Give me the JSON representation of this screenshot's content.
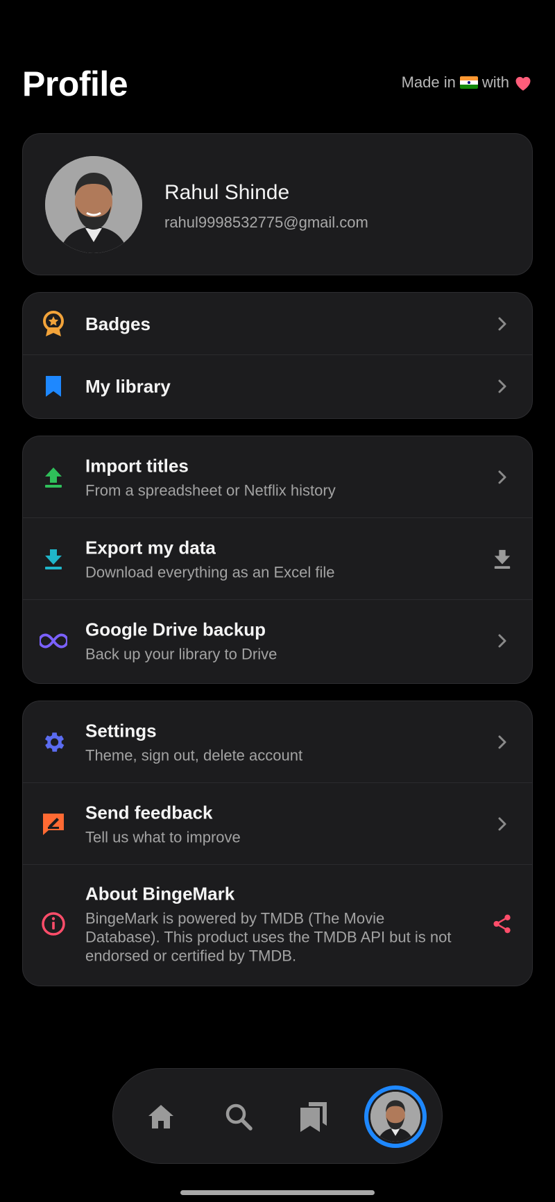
{
  "header": {
    "title": "Profile",
    "made_in_prefix": "Made in",
    "made_in_suffix": "with"
  },
  "profile": {
    "name": "Rahul Shinde",
    "email": "rahul9998532775@gmail.com"
  },
  "group_main": [
    {
      "label": "Badges",
      "icon": "badge-icon",
      "icon_color": "#f2a33a"
    },
    {
      "label": "My library",
      "icon": "bookmark-icon",
      "icon_color": "#1e88ff"
    }
  ],
  "group_data": [
    {
      "label": "Import titles",
      "sub": "From a spreadsheet or Netflix history",
      "icon": "upload-icon",
      "icon_color": "#2fbf5a"
    },
    {
      "label": "Export my data",
      "sub": "Download everything as an Excel file",
      "icon": "download-icon",
      "icon_color": "#1fb5c9"
    },
    {
      "label": "Google Drive backup",
      "sub": "Back up your library to Drive",
      "icon": "infinity-icon",
      "icon_color": "#7b61ff"
    }
  ],
  "group_app": [
    {
      "label": "Settings",
      "sub": "Theme, sign out, delete account",
      "icon": "gear-icon",
      "icon_color": "#5b6cf0"
    },
    {
      "label": "Send feedback",
      "sub": "Tell us what to improve",
      "icon": "feedback-icon",
      "icon_color": "#ff6a33"
    },
    {
      "label": "About BingeMark",
      "sub": "BingeMark is powered by TMDB (The Movie Database). This product uses the TMDB API but is not endorsed or certified by TMDB.",
      "icon": "info-icon",
      "icon_color": "#ff4d6a"
    }
  ],
  "nav": {
    "items": [
      "home-icon",
      "search-icon",
      "library-icon",
      "profile-avatar"
    ],
    "active": "profile-avatar",
    "active_color": "#1e88ff"
  }
}
